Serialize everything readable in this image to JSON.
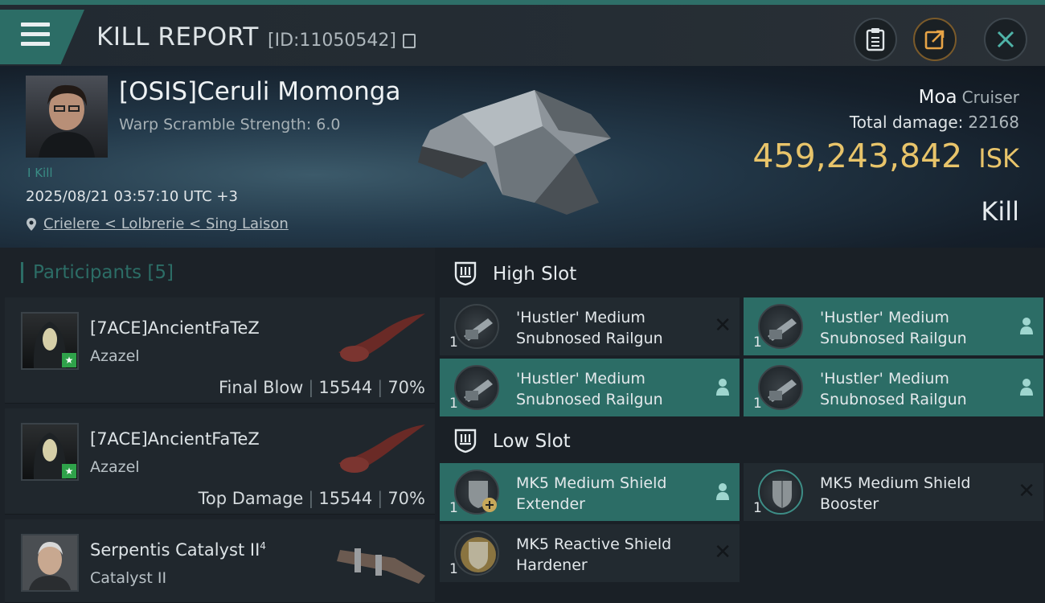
{
  "header": {
    "title": "KILL REPORT",
    "report_id": "[ID:11050542]",
    "icons": [
      "menu-icon",
      "copy-icon",
      "clipboard-icon",
      "share-icon",
      "close-icon"
    ]
  },
  "victim": {
    "pilot": "[OSIS]Ceruli Momonga",
    "warp_scramble": "Warp Scramble Strength: 6.0",
    "kills": "I Kill",
    "datetime": "2025/08/21 03:57:10 UTC +3",
    "location": "Crielere < Lolbrerie < Sing Laison",
    "ship": "Moa",
    "ship_class": "Cruiser",
    "total_damage_label": "Total damage:",
    "total_damage": "22168",
    "isk_value": "459,243,842",
    "isk_unit": "ISK",
    "result": "Kill"
  },
  "participants": {
    "header": "Participants",
    "count": "[5]",
    "rows": [
      {
        "name": "[7ACE]AncientFaTeZ",
        "ship": "Azazel",
        "tag": "Final Blow",
        "damage": "15544",
        "percent": "70%"
      },
      {
        "name": "[7ACE]AncientFaTeZ",
        "ship": "Azazel",
        "tag": "Top Damage",
        "damage": "15544",
        "percent": "70%"
      },
      {
        "name": "Serpentis Catalyst II",
        "name_sup": "4",
        "ship": "Catalyst II"
      }
    ]
  },
  "fitting": {
    "high_slot": "High Slot",
    "low_slot": "Low Slot",
    "high": [
      {
        "line1": "'Hustler' Medium",
        "line2": "Snubnosed Railgun",
        "qty": "1",
        "status": "destroyed"
      },
      {
        "line1": "'Hustler' Medium",
        "line2": "Snubnosed Railgun",
        "qty": "1",
        "status": "dropped"
      },
      {
        "line1": "'Hustler' Medium",
        "line2": "Snubnosed Railgun",
        "qty": "1",
        "status": "dropped"
      },
      {
        "line1": "'Hustler' Medium",
        "line2": "Snubnosed Railgun",
        "qty": "1",
        "status": "dropped"
      }
    ],
    "low": [
      {
        "line1": "MK5 Medium Shield",
        "line2": "Extender",
        "qty": "1",
        "status": "dropped"
      },
      {
        "line1": "MK5 Medium Shield",
        "line2": "Booster",
        "qty": "1",
        "status": "destroyed"
      },
      {
        "line1": "MK5 Reactive Shield",
        "line2": "Hardener",
        "qty": "1",
        "status": "destroyed"
      }
    ]
  },
  "colors": {
    "accent": "#2c6d66",
    "isk": "#e8c46a",
    "panel": "#222a30"
  }
}
